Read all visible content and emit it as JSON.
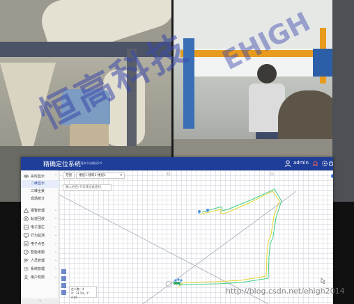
{
  "app": {
    "title": "精确定位系统",
    "subtitle": "基本平台概况0.0"
  },
  "header": {
    "user_name": "admin"
  },
  "sidebar": {
    "items": [
      {
        "label": "实时显示",
        "icon": "eye-icon",
        "expanded": true
      },
      {
        "label": "报警管理",
        "icon": "warning-icon"
      },
      {
        "label": "轨迹回放",
        "icon": "play-icon"
      },
      {
        "label": "电子围栏",
        "icon": "fence-icon"
      },
      {
        "label": "行为监测",
        "icon": "monitor-icon"
      },
      {
        "label": "电子点名",
        "icon": "rollcall-icon"
      },
      {
        "label": "智能考勤",
        "icon": "clock-icon"
      },
      {
        "label": "人员管理",
        "icon": "people-icon"
      },
      {
        "label": "系统管理",
        "icon": "gear-icon"
      },
      {
        "label": "用户权限",
        "icon": "user-icon"
      }
    ],
    "sub_items": [
      {
        "label": "二维显示",
        "active": true
      },
      {
        "label": "三维全景"
      },
      {
        "label": "现场统计"
      }
    ],
    "collapse_label": "‹"
  },
  "map": {
    "toolbar_label": "范围",
    "floor_select_value": "楼层1-建筑1-楼层1",
    "search_placeholder": "输入姓名/卡号或设备查找",
    "info_lines": [
      "在人数：4",
      "X：31.54，Y：4.40"
    ]
  },
  "overlay": {
    "watermark": "恒高科技",
    "watermark_en": "EHIGH",
    "credit": "http://blog.csdn.net/ehigh2014"
  },
  "colors": {
    "header_bg": "#1f3e99",
    "path_yellow": "#e3d630",
    "path_green": "#3fcf86",
    "path_blue": "#4a8fe0"
  }
}
